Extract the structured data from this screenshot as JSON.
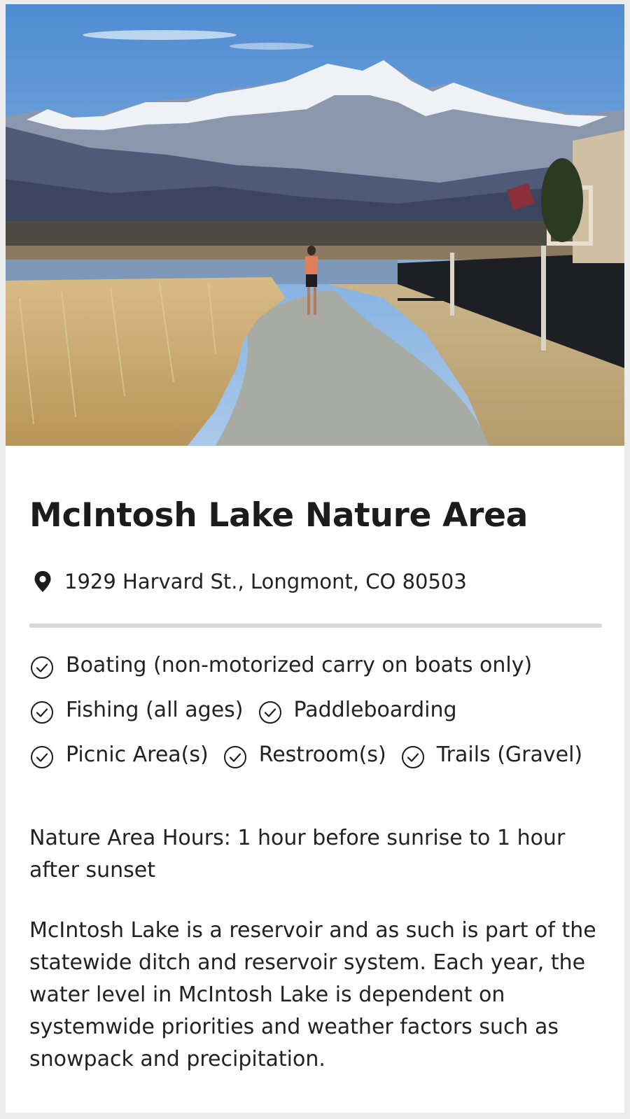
{
  "park": {
    "name": "McIntosh Lake Nature Area",
    "address": "1929 Harvard St., Longmont, CO 80503",
    "amenities": [
      "Boating (non-motorized carry on boats only)",
      "Fishing (all ages)",
      "Paddleboarding",
      "Picnic Area(s)",
      "Restroom(s)",
      "Trails (Gravel)"
    ],
    "hours": "Nature Area Hours: 1 hour before sunrise to 1 hour after sunset",
    "description": "McIntosh Lake is a reservoir and as such is part of the statewide ditch and reservoir system. Each year, the water level in McIntosh Lake is dependent on systemwide priorities and weather factors such as snowpack and precipitation."
  },
  "icons": {
    "location": "map-pin-icon",
    "amenity": "check-circle-icon"
  },
  "colors": {
    "sky": "#5c93d0",
    "grass": "#c9a86a",
    "path": "#a8aba3",
    "text": "#1f1f1f"
  }
}
